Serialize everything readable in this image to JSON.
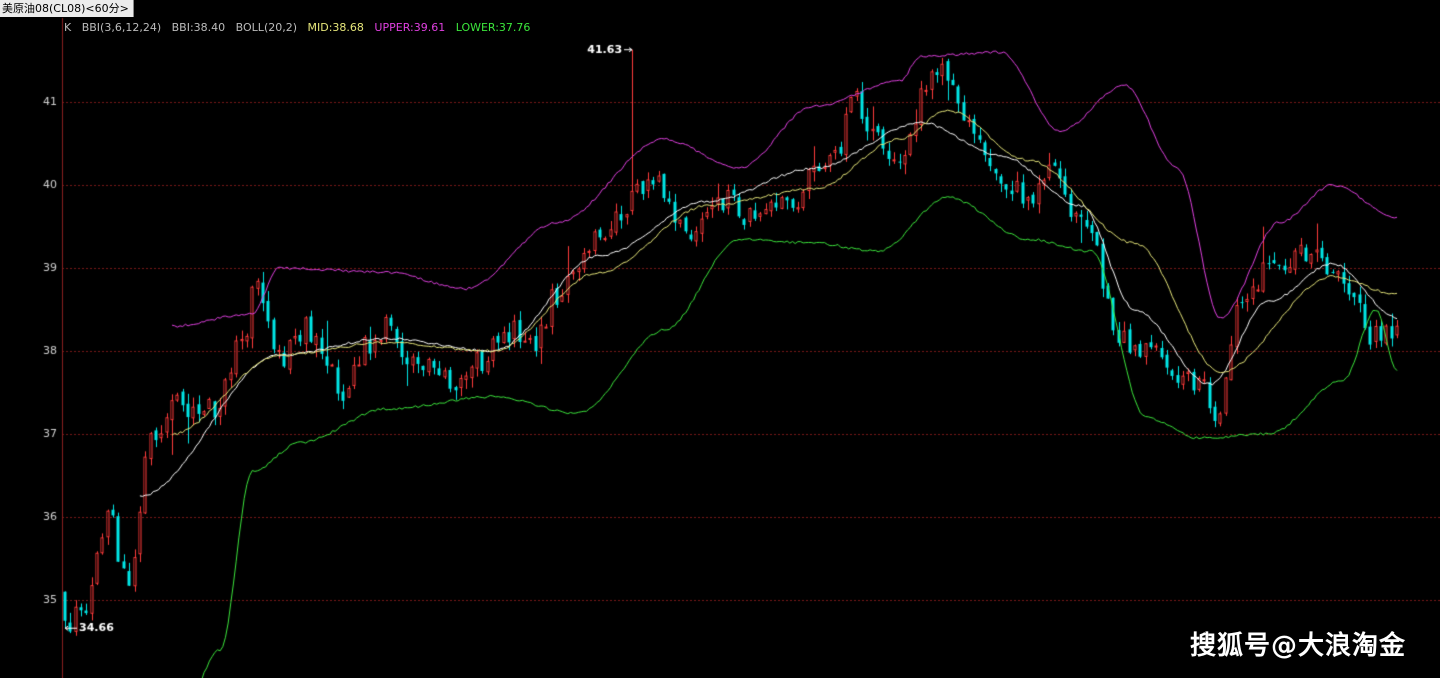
{
  "window": {
    "title": "美原油08(CL08)<60分>"
  },
  "legend": {
    "k_label": "K",
    "bbi_params": "BBI(3,6,12,24)",
    "bbi_value": "BBI:38.40",
    "boll_params": "BOLL(20,2)",
    "mid_value": "MID:38.68",
    "upper_value": "UPPER:39.61",
    "lower_value": "LOWER:37.76"
  },
  "watermark": "搜狐号@大浪淘金",
  "colors": {
    "background": "#000000",
    "up_candle": "#ff3b3b",
    "down_candle": "#00e6e6",
    "bbi_line": "#ffffff",
    "mid_line": "#e6e67a",
    "upper_line": "#e040e0",
    "lower_line": "#3ce63c",
    "grid": "#7a1a1a",
    "axis_text": "#d0d0d0"
  },
  "chart_data": {
    "type": "candlestick",
    "title": "",
    "y_axis": {
      "ticks": [
        35,
        36,
        37,
        38,
        39,
        40,
        41
      ],
      "ylim": [
        34.4,
        41.95
      ]
    },
    "grid": true,
    "annotations": {
      "high_label": "41.63",
      "high_value": 41.63,
      "high_index": 106,
      "low_label": "34.66",
      "low_value": 34.66,
      "low_index": 0
    },
    "close_path": [
      [
        0,
        34.72
      ],
      [
        4,
        35.0
      ],
      [
        8,
        36.05
      ],
      [
        12,
        35.1
      ],
      [
        16,
        36.85
      ],
      [
        20,
        37.45
      ],
      [
        24,
        37.3
      ],
      [
        28,
        37.35
      ],
      [
        33,
        38.05
      ],
      [
        36,
        38.85
      ],
      [
        40,
        37.9
      ],
      [
        45,
        38.3
      ],
      [
        52,
        37.55
      ],
      [
        57,
        38.1
      ],
      [
        60,
        38.35
      ],
      [
        63,
        38.05
      ],
      [
        66,
        37.8
      ],
      [
        69,
        37.95
      ],
      [
        72,
        37.55
      ],
      [
        76,
        37.8
      ],
      [
        80,
        38.0
      ],
      [
        84,
        38.25
      ],
      [
        88,
        38.15
      ],
      [
        92,
        38.7
      ],
      [
        96,
        39.1
      ],
      [
        100,
        39.35
      ],
      [
        104,
        39.6
      ],
      [
        108,
        40.05
      ],
      [
        112,
        39.95
      ],
      [
        116,
        39.35
      ],
      [
        120,
        39.7
      ],
      [
        124,
        39.85
      ],
      [
        128,
        39.6
      ],
      [
        132,
        39.75
      ],
      [
        136,
        39.65
      ],
      [
        140,
        40.15
      ],
      [
        144,
        40.45
      ],
      [
        148,
        41.0
      ],
      [
        152,
        40.5
      ],
      [
        156,
        40.35
      ],
      [
        158,
        40.6
      ],
      [
        161,
        41.15
      ],
      [
        164,
        41.5
      ],
      [
        167,
        41.05
      ],
      [
        170,
        40.55
      ],
      [
        173,
        40.35
      ],
      [
        176,
        40.0
      ],
      [
        180,
        39.85
      ],
      [
        184,
        40.25
      ],
      [
        188,
        39.7
      ],
      [
        192,
        39.45
      ],
      [
        196,
        38.3
      ],
      [
        200,
        38.0
      ],
      [
        204,
        37.95
      ],
      [
        208,
        37.75
      ],
      [
        212,
        37.6
      ],
      [
        216,
        37.25
      ],
      [
        219,
        38.45
      ],
      [
        222,
        38.75
      ],
      [
        226,
        39.1
      ],
      [
        230,
        39.15
      ],
      [
        234,
        39.15
      ],
      [
        238,
        39.0
      ],
      [
        241,
        38.7
      ],
      [
        245,
        38.15
      ],
      [
        249,
        38.2
      ]
    ],
    "indicator_lines": [
      {
        "name": "BBI",
        "pts": [
          [
            14,
            36.25
          ],
          [
            40,
            37.95
          ],
          [
            60,
            38.15
          ],
          [
            80,
            38.0
          ],
          [
            100,
            39.15
          ],
          [
            120,
            39.8
          ],
          [
            140,
            40.2
          ],
          [
            160,
            40.75
          ],
          [
            175,
            40.35
          ],
          [
            190,
            39.75
          ],
          [
            200,
            38.5
          ],
          [
            214,
            37.6
          ],
          [
            225,
            38.6
          ],
          [
            237,
            39.05
          ],
          [
            249,
            38.4
          ]
        ]
      },
      {
        "name": "MID",
        "pts": [
          [
            20,
            37.0
          ],
          [
            40,
            37.95
          ],
          [
            60,
            38.1
          ],
          [
            80,
            38.0
          ],
          [
            100,
            38.95
          ],
          [
            120,
            39.75
          ],
          [
            140,
            39.95
          ],
          [
            156,
            40.55
          ],
          [
            165,
            40.9
          ],
          [
            180,
            40.3
          ],
          [
            200,
            39.3
          ],
          [
            216,
            37.75
          ],
          [
            237,
            38.9
          ],
          [
            249,
            38.68
          ]
        ]
      },
      {
        "name": "UPPER",
        "pts": [
          [
            20,
            38.3
          ],
          [
            35,
            38.45
          ],
          [
            40,
            39.0
          ],
          [
            60,
            38.95
          ],
          [
            75,
            38.75
          ],
          [
            92,
            39.55
          ],
          [
            112,
            40.55
          ],
          [
            126,
            40.2
          ],
          [
            140,
            40.95
          ],
          [
            156,
            41.25
          ],
          [
            160,
            41.55
          ],
          [
            175,
            41.6
          ],
          [
            186,
            40.65
          ],
          [
            198,
            41.2
          ],
          [
            208,
            40.2
          ],
          [
            216,
            38.4
          ],
          [
            227,
            39.55
          ],
          [
            237,
            40.0
          ],
          [
            249,
            39.61
          ]
        ]
      },
      {
        "name": "LOWER",
        "pts": [
          [
            20,
            33.3
          ],
          [
            29,
            34.4
          ],
          [
            35,
            36.55
          ],
          [
            44,
            36.9
          ],
          [
            60,
            37.3
          ],
          [
            80,
            37.45
          ],
          [
            96,
            37.25
          ],
          [
            112,
            38.25
          ],
          [
            126,
            39.35
          ],
          [
            140,
            39.3
          ],
          [
            152,
            39.2
          ],
          [
            165,
            39.85
          ],
          [
            180,
            39.35
          ],
          [
            192,
            39.2
          ],
          [
            202,
            37.2
          ],
          [
            212,
            36.95
          ],
          [
            225,
            37.0
          ],
          [
            239,
            37.65
          ],
          [
            245,
            38.5
          ],
          [
            249,
            37.76
          ]
        ]
      }
    ]
  }
}
